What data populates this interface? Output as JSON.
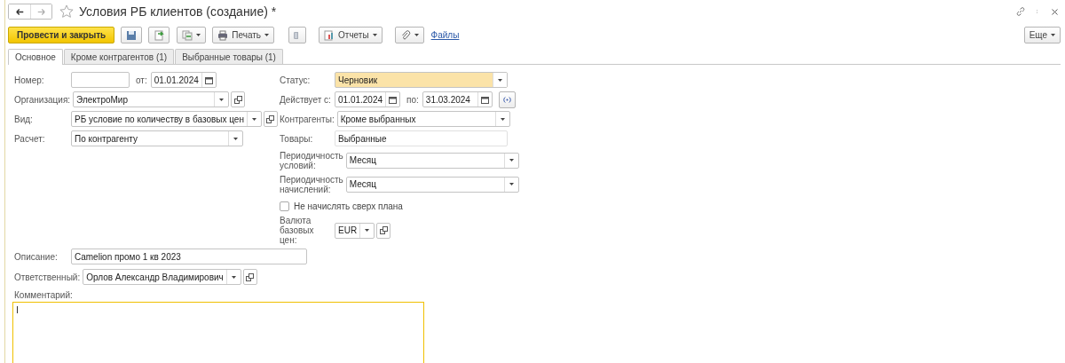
{
  "window": {
    "title": "Условия РБ клиентов (создание) *",
    "favorite": false
  },
  "toolbar": {
    "primary_button": "Провести и закрыть",
    "print_button": "Печать",
    "reports_button": "Отчеты",
    "files_link": "Файлы",
    "more_button": "Еще"
  },
  "tabs": [
    {
      "label": "Основное",
      "selected": true
    },
    {
      "label": "Кроме контрагентов (1)",
      "selected": false
    },
    {
      "label": "Выбранные товары (1)",
      "selected": false
    }
  ],
  "number": {
    "label": "Номер:",
    "date_label": "от:",
    "date": "01.01.2024"
  },
  "left_fields": [
    {
      "label": "Организация:",
      "value": "ЭлектроМир",
      "kind": "dropdown-link"
    },
    {
      "label": "Вид:",
      "value": "РБ условие по количеству в базовых цен",
      "kind": "dropdown-link"
    },
    {
      "label": "Расчет:",
      "value": "По контрагенту",
      "kind": "dropdown"
    }
  ],
  "status": {
    "label": "Статус:",
    "value": "Черновик",
    "highlighted": true
  },
  "period": {
    "label": "Действует с:",
    "from": "01.01.2024",
    "to_label": "по:",
    "to": "31.03.2024"
  },
  "right_fields": [
    {
      "label": "Контрагенты:",
      "value": "Кроме выбранных",
      "kind": "dropdown"
    },
    {
      "label": "Товары:",
      "value": "Выбранные",
      "kind": "readonly"
    },
    {
      "label": "Периодичность условий:",
      "value": "Месяц",
      "kind": "dropdown"
    },
    {
      "label": "Периодичность начислений:",
      "value": "Месяц",
      "kind": "dropdown"
    }
  ],
  "checkbox": {
    "label": "Не начислять сверх плана",
    "checked": false
  },
  "currency": {
    "label": "Валюта базовых цен:",
    "value": "EUR"
  },
  "description": {
    "label": "Описание:",
    "value": "Camelion промо 1 кв 2023"
  },
  "responsible": {
    "label": "Ответственный:",
    "value": "Орлов Александр Владимирович"
  },
  "comment": {
    "label": "Комментарий:"
  }
}
